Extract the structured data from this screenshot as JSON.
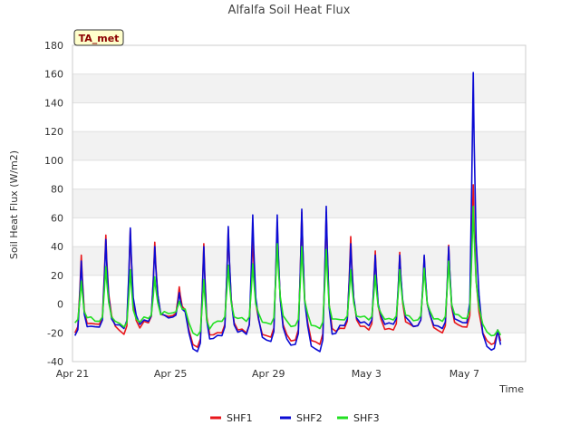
{
  "chart_data": {
    "type": "line",
    "title": "Alfalfa Soil Heat Flux",
    "xlabel": "Time",
    "ylabel": "Soil Heat Flux (W/m2)",
    "badge": "TA_met",
    "ylim": [
      -40,
      180
    ],
    "xlim": [
      0,
      18.5
    ],
    "yticks": [
      -40,
      -20,
      0,
      20,
      40,
      60,
      80,
      100,
      120,
      140,
      160,
      180
    ],
    "xticks": [
      {
        "x": 0,
        "label": "Apr 21"
      },
      {
        "x": 4,
        "label": "Apr 25"
      },
      {
        "x": 8,
        "label": "Apr 29"
      },
      {
        "x": 12,
        "label": "May 3"
      },
      {
        "x": 16,
        "label": "May 7"
      }
    ],
    "grid": true,
    "legend_position": "bottom-center",
    "days": [
      0,
      1,
      2,
      3,
      4,
      5,
      6,
      7,
      8,
      9,
      10,
      11,
      12,
      13,
      14,
      15,
      16,
      17
    ],
    "series": [
      {
        "name": "SHF1",
        "color": "#e8171c",
        "peaks": [
          34,
          48,
          52,
          43,
          12,
          42,
          52,
          48,
          57,
          64,
          64,
          47,
          37,
          36,
          33,
          41,
          83,
          -18
        ],
        "troughs": [
          -20,
          -14,
          -21,
          -13,
          -8,
          -30,
          -20,
          -20,
          -23,
          -25,
          -28,
          -17,
          -18,
          -18,
          -15,
          -20,
          -16,
          -28
        ]
      },
      {
        "name": "SHF2",
        "color": "#0b0bd4",
        "peaks": [
          30,
          45,
          53,
          40,
          8,
          40,
          54,
          62,
          62,
          66,
          68,
          42,
          34,
          34,
          34,
          40,
          161,
          -18
        ],
        "troughs": [
          -22,
          -16,
          -17,
          -12,
          -9,
          -33,
          -22,
          -21,
          -26,
          -28,
          -33,
          -15,
          -15,
          -14,
          -15,
          -17,
          -13,
          -32
        ]
      },
      {
        "name": "SHF3",
        "color": "#22e022",
        "peaks": [
          16,
          26,
          24,
          19,
          2,
          17,
          27,
          28,
          42,
          40,
          38,
          24,
          20,
          24,
          25,
          30,
          68,
          -18
        ],
        "troughs": [
          -13,
          -12,
          -16,
          -10,
          -6,
          -22,
          -12,
          -12,
          -14,
          -15,
          -17,
          -11,
          -11,
          -11,
          -11,
          -12,
          -10,
          -22
        ]
      }
    ]
  }
}
